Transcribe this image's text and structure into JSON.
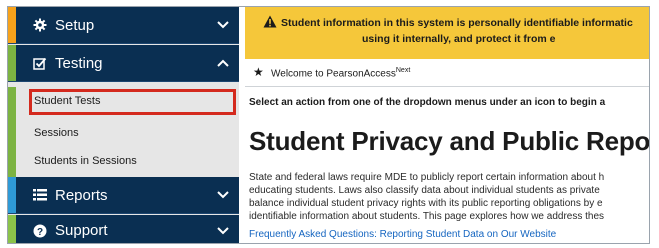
{
  "sidebar": {
    "setup": {
      "label": "Setup",
      "icon": "gear-icon",
      "accent": "#f7a21b"
    },
    "testing": {
      "label": "Testing",
      "icon": "checkbox-icon",
      "accent": "#7cb342",
      "items": [
        {
          "label": "Student Tests",
          "highlighted": true
        },
        {
          "label": "Sessions"
        },
        {
          "label": "Students in Sessions"
        }
      ]
    },
    "reports": {
      "label": "Reports",
      "icon": "reports-icon",
      "accent": "#2e9ad7"
    },
    "support": {
      "label": "Support",
      "icon": "help-icon",
      "accent": "#8bc34a"
    }
  },
  "main": {
    "alert": {
      "line1": "Student information in this system is personally identifiable informatic",
      "line2": "using it internally, and protect it from e"
    },
    "welcome": {
      "text": "Welcome to PearsonAccess",
      "sup": "Next"
    },
    "instruction": "Select an action from one of the dropdown menus under an icon to begin a",
    "heading": "Student Privacy and Public Repor",
    "paragraph": [
      "State and federal laws require MDE to publicly report certain information about h",
      "educating students. Laws also classify data about individual students as private",
      "balance individual student privacy rights with its public reporting obligations by e",
      "identifiable information about students. This page explores how we address thes"
    ],
    "faq_link": "Frequently Asked Questions: Reporting Student Data on Our Website"
  },
  "colors": {
    "nav_bg": "#0a2f52",
    "alert_bg": "#f5c73a",
    "highlight_border": "#d42a1e",
    "link": "#1565c0"
  }
}
